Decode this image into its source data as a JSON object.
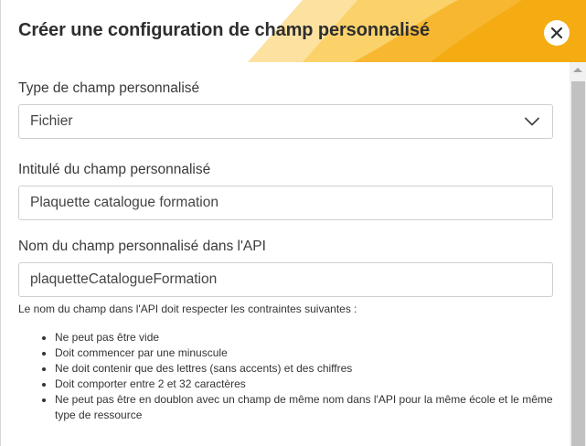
{
  "dialog": {
    "title": "Créer une configuration de champ personnalisé",
    "close_icon": "close-icon",
    "colors": {
      "accent_dark": "#f4b400",
      "accent_mid": "#fbc33a",
      "accent_light": "#fde1a0",
      "title_text": "#2e2e2e"
    }
  },
  "form": {
    "field_type": {
      "label": "Type de champ personnalisé",
      "selected": "Fichier",
      "icon": "chevron-down-icon"
    },
    "field_label": {
      "label": "Intitulé du champ personnalisé",
      "value": "Plaquette catalogue formation"
    },
    "api_name": {
      "label": "Nom du champ personnalisé dans l'API",
      "value": "plaquetteCatalogueFormation",
      "help": "Le nom du champ dans l'API doit respecter les contraintes suivantes :",
      "rules": [
        "Ne peut pas être vide",
        "Doit commencer par une minuscule",
        "Ne doit contenir que des lettres (sans accents) et des chiffres",
        "Doit comporter entre 2 et 32 caractères",
        "Ne peut pas être en doublon avec un champ de même nom dans l'API pour la même école et le même type de ressource"
      ]
    }
  }
}
